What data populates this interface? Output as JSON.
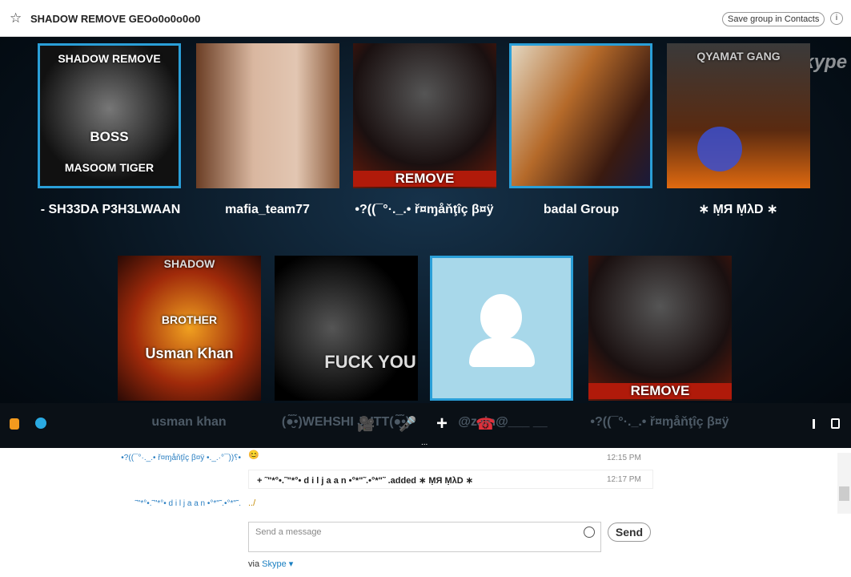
{
  "header": {
    "title": "SHADOW REMOVE GEOo0o0o0o0",
    "save_label": "Save group in Contacts",
    "info": "i",
    "star": "☆"
  },
  "stage": {
    "logo": "skype",
    "row1": [
      {
        "name": "-          SH33DA P3H3LWAAN",
        "caption_top": "SHADOW REMOVE",
        "caption_mid": "BOSS",
        "caption_bot": "MASOOM TIGER"
      },
      {
        "name": "mafia_team77"
      },
      {
        "name": "•?((¯°·._.• ř¤ɱåňţîç β¤ÿ",
        "caption_bot": "REMOVE"
      },
      {
        "name": "badal Group"
      },
      {
        "name": "∗ ṂЯ ṂλD ∗",
        "caption_top": "QYAMAT GANG"
      }
    ],
    "row2": [
      {
        "name": "usman khan",
        "caption_top": "SHADOW",
        "caption_mid": "BROTHER",
        "caption_bot": "Usman Khan"
      },
      {
        "name": "(●̮̮̃•̃)WEHSHI JUTT(●̮̮̃•̃)",
        "caption_bot": "FUCK YOU"
      },
      {
        "name": "@zain@___ __"
      },
      {
        "name": "•?((¯°·._.• ř¤ɱåňţîç β¤ÿ",
        "caption_bot": "REMOVE"
      }
    ]
  },
  "controls": {
    "video": "🎥",
    "mic": "🎤",
    "add": "+",
    "hangup": "☎",
    "more": "..."
  },
  "chat": {
    "messages": [
      {
        "sender": "•?((¯°·._.• ř¤ɱåňţîç β¤ÿ •._.·°¯))؟•",
        "text": "😊",
        "time": "12:15 PM"
      },
      {
        "sender": "",
        "text": "+  ˜\"*°•.˜\"*°• d i l j a a n •°*\"˜.•°*\"˜ .added ∗ ṂЯ ṂλD ∗",
        "time": "12:17 PM"
      },
      {
        "sender": "˜\"*°•.˜\"*°• d i l j a a n •°*\"˜.•°*\"˜.",
        "text": "../",
        "time": ""
      }
    ],
    "placeholder": "Send a message",
    "send_label": "Send",
    "via": "via",
    "via_link": "Skype ▾"
  }
}
